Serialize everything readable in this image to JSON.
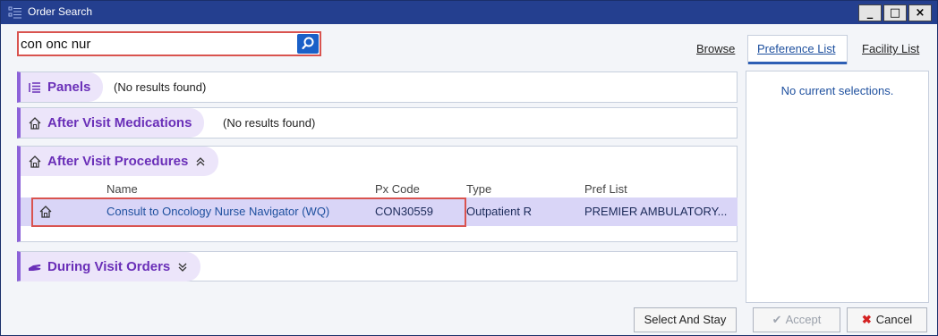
{
  "window": {
    "title": "Order Search",
    "min_label": "_",
    "max_label": "□",
    "close_label": "×"
  },
  "search": {
    "value": "con onc nur",
    "button_icon": "search-icon"
  },
  "tabs": {
    "browse": "Browse",
    "preference_list": "Preference List",
    "facility_list": "Facility List",
    "active": "Preference List"
  },
  "right_pane": {
    "empty_text": "No current selections."
  },
  "sections": {
    "panels": {
      "title": "Panels",
      "status": "(No results found)",
      "icon": "panels-icon"
    },
    "after_visit_medications": {
      "title": "After Visit Medications",
      "status": "(No results found)",
      "icon": "home-icon"
    },
    "after_visit_procedures": {
      "title": "After Visit Procedures",
      "icon": "home-icon",
      "chevron": "≈",
      "columns": {
        "name": "Name",
        "px_code": "Px Code",
        "type": "Type",
        "pref_list": "Pref List"
      },
      "rows": [
        {
          "name": "Consult to Oncology Nurse Navigator (WQ)",
          "px_code": "CON30559",
          "type": "Outpatient R",
          "pref_list": "PREMIER AMBULATORY..."
        }
      ]
    },
    "during_visit_orders": {
      "title": "During Visit Orders",
      "icon": "hand-icon"
    }
  },
  "buttons": {
    "select_and_stay": "Select And Stay",
    "accept": "Accept",
    "cancel": "Cancel"
  },
  "colors": {
    "titlebar": "#243f8f",
    "section_title": "#6a2fb8",
    "highlight": "#d9534f",
    "selected_row": "#d9d5f7"
  }
}
